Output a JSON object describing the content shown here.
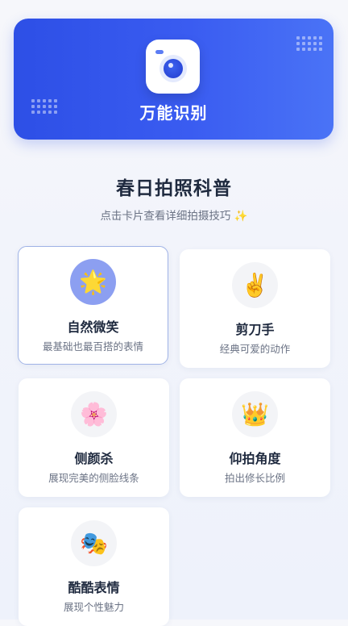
{
  "banner": {
    "title": "万能识别",
    "icon": "camera-icon",
    "color_start": "#2d4fe6",
    "color_end": "#4a73f6"
  },
  "section": {
    "title": "春日拍照科普",
    "subtitle": "点击卡片查看详细拍摄技巧 ✨"
  },
  "cards": [
    {
      "title": "自然微笑",
      "desc": "最基础也最百搭的表情",
      "icon": "🌟",
      "icon_name": "star-icon",
      "selected": true
    },
    {
      "title": "剪刀手",
      "desc": "经典可爱的动作",
      "icon": "✌️",
      "icon_name": "victory-hand-icon",
      "selected": false
    },
    {
      "title": "侧颜杀",
      "desc": "展现完美的侧脸线条",
      "icon": "🌸",
      "icon_name": "cherry-blossom-icon",
      "selected": false
    },
    {
      "title": "仰拍角度",
      "desc": "拍出修长比例",
      "icon": "👑",
      "icon_name": "crown-icon",
      "selected": false
    },
    {
      "title": "酷酷表情",
      "desc": "展现个性魅力",
      "icon": "🎭",
      "icon_name": "theater-masks-icon",
      "selected": false
    }
  ],
  "colors": {
    "title_text": "#1f2a3f",
    "sub_text": "#6b7385",
    "selected_border": "#9fb2e6",
    "selected_icon_bg": "#8c9ff1"
  }
}
